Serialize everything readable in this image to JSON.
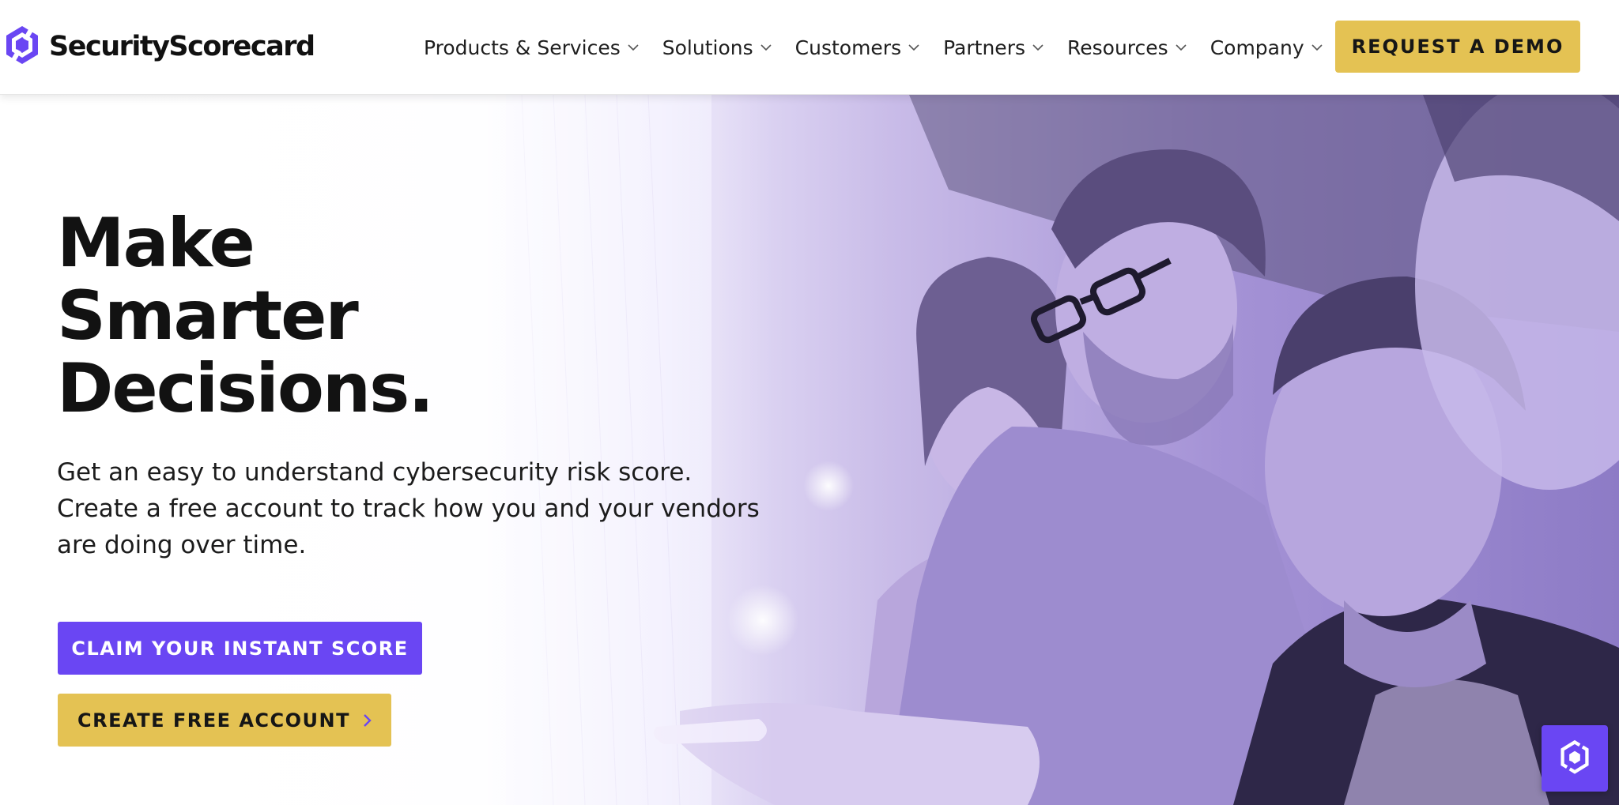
{
  "colors": {
    "brand_purple": "#6a46f3",
    "accent_gold": "#e4c253",
    "text_dark": "#121212",
    "header_bg": "#ffffff"
  },
  "header": {
    "logo": {
      "icon": "securityscorecard-logo-icon",
      "text": "SecurityScorecard"
    },
    "nav": [
      {
        "label": "Products & Services",
        "icon": "chevron-down-icon"
      },
      {
        "label": "Solutions",
        "icon": "chevron-down-icon"
      },
      {
        "label": "Customers",
        "icon": "chevron-down-icon"
      },
      {
        "label": "Partners",
        "icon": "chevron-down-icon"
      },
      {
        "label": "Resources",
        "icon": "chevron-down-icon"
      },
      {
        "label": "Company",
        "icon": "chevron-down-icon"
      }
    ],
    "cta_label": "REQUEST A DEMO"
  },
  "hero": {
    "headline": [
      "Make",
      "Smarter",
      "Decisions."
    ],
    "subtext": [
      "Get an easy to understand cybersecurity risk score.",
      "Create a free account to track how you and your vendors",
      "are doing over time."
    ],
    "primary_button": "CLAIM YOUR INSTANT SCORE",
    "secondary_button": "CREATE FREE ACCOUNT",
    "secondary_button_icon": "chevron-right-icon",
    "image": "people-looking-at-screen-photo"
  },
  "chat_widget": {
    "icon": "securityscorecard-chat-icon"
  }
}
